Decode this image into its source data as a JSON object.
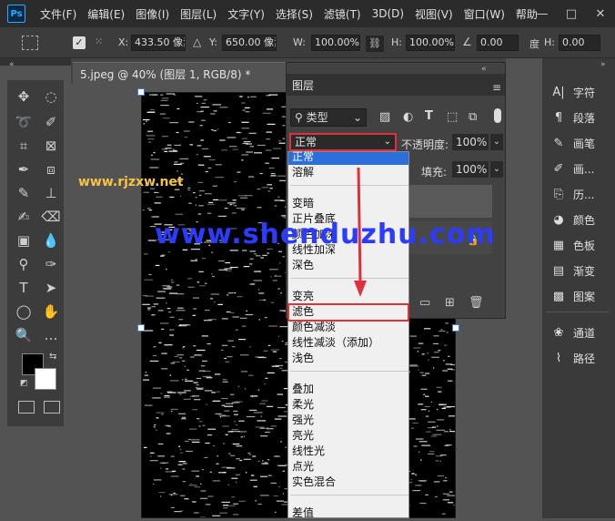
{
  "app": {
    "logo": "Ps"
  },
  "menubar": {
    "items": [
      "文件(F)",
      "编辑(E)",
      "图像(I)",
      "图层(L)",
      "文字(Y)",
      "选择(S)",
      "滤镜(T)",
      "3D(D)",
      "视图(V)",
      "窗口(W)",
      "帮助"
    ],
    "minimize": "—",
    "maximize": "□",
    "close": "✕"
  },
  "options": {
    "x_label": "X:",
    "x_value": "433.50 像素",
    "y_label": "Y:",
    "y_value": "650.00 像素",
    "w_label": "W:",
    "w_value": "100.00%",
    "h_label": "H:",
    "h_value": "100.00%",
    "angle_value": "0.00",
    "degree_label": "度",
    "hskew_label": "H:",
    "hskew_value": "0.00"
  },
  "document": {
    "tab_title": "5.jpeg @ 40% (图层 1, RGB/8) *",
    "close": "✕"
  },
  "layers_panel": {
    "title": "图层",
    "filter_kind": "类型",
    "blend_mode": "正常",
    "opacity_label": "不透明度:",
    "opacity_value": "100%",
    "fill_label": "填充:",
    "fill_value": "100%"
  },
  "blend_menu": {
    "groups": [
      [
        "正常",
        "溶解"
      ],
      [
        "变暗",
        "正片叠底",
        "颜色加深",
        "线性加深",
        "深色"
      ],
      [
        "变亮",
        "滤色",
        "颜色减淡",
        "线性减淡（添加）",
        "浅色"
      ],
      [
        "叠加",
        "柔光",
        "强光",
        "亮光",
        "线性光",
        "点光",
        "实色混合"
      ],
      [
        "差值"
      ]
    ],
    "selected": "正常",
    "highlighted": "滤色"
  },
  "right_panels": [
    {
      "icon": "character-icon",
      "glyph": "A|",
      "label": "字符"
    },
    {
      "icon": "paragraph-icon",
      "glyph": "¶",
      "label": "段落"
    },
    {
      "icon": "brush-icon",
      "glyph": "✎",
      "label": "画笔"
    },
    {
      "icon": "brush-preset-icon",
      "glyph": "✐",
      "label": "画..."
    },
    {
      "icon": "history-icon",
      "glyph": "⎘",
      "label": "历..."
    },
    {
      "icon": "color-icon",
      "glyph": "◕",
      "label": "颜色"
    },
    {
      "icon": "swatches-icon",
      "glyph": "▦",
      "label": "色板"
    },
    {
      "icon": "gradient-icon",
      "glyph": "▤",
      "label": "渐变"
    },
    {
      "icon": "pattern-icon",
      "glyph": "▩",
      "label": "图案"
    },
    {
      "icon": "channels-icon",
      "glyph": "❀",
      "label": "通道"
    },
    {
      "icon": "paths-icon",
      "glyph": "⌇",
      "label": "路径"
    }
  ],
  "watermarks": {
    "small": "www.rjzxw.net",
    "big": "www.shenduzhu.com"
  },
  "colors": {
    "accent_red": "#e0303a",
    "selection_blue": "#2a6fdb",
    "watermark_blue": "#2b3cff",
    "watermark_yellow": "#f6c445"
  }
}
